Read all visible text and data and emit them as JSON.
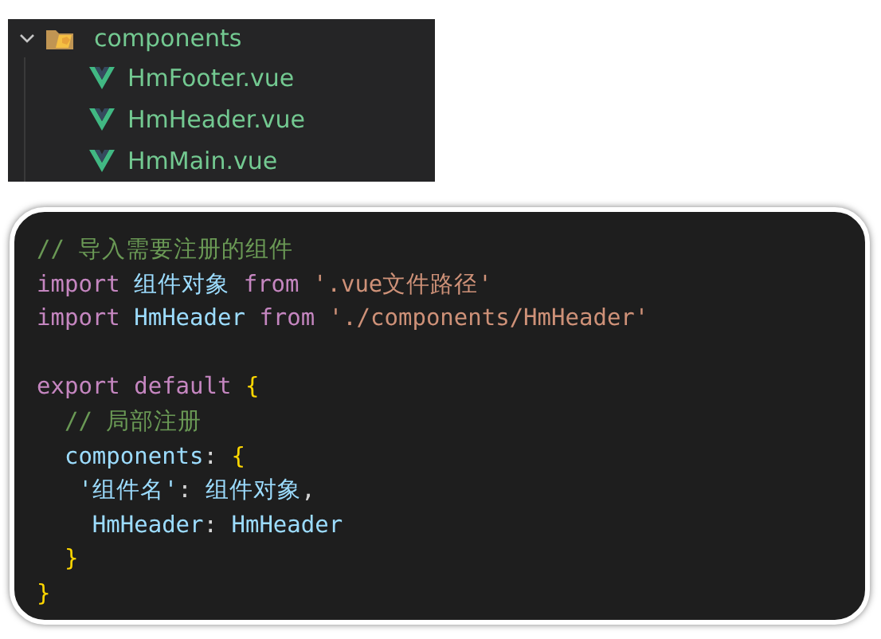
{
  "explorer": {
    "folder": {
      "name": "components",
      "expanded": true,
      "children": [
        {
          "name": "HmFooter.vue"
        },
        {
          "name": "HmHeader.vue"
        },
        {
          "name": "HmMain.vue"
        }
      ]
    }
  },
  "code": {
    "lines": [
      {
        "kind": "code",
        "tokens": [
          {
            "text": "// 导入需要注册的组件",
            "kind": "comment"
          }
        ]
      },
      {
        "kind": "code",
        "tokens": [
          {
            "text": "import ",
            "kind": "keyword"
          },
          {
            "text": "组件对象 ",
            "kind": "identifier"
          },
          {
            "text": "from ",
            "kind": "keyword"
          },
          {
            "text": "'.vue文件路径'",
            "kind": "string"
          }
        ]
      },
      {
        "kind": "code",
        "tokens": [
          {
            "text": "import ",
            "kind": "keyword"
          },
          {
            "text": "HmHeader ",
            "kind": "identifier"
          },
          {
            "text": "from ",
            "kind": "keyword"
          },
          {
            "text": "'./components/HmHeader'",
            "kind": "string"
          }
        ]
      },
      {
        "kind": "blank"
      },
      {
        "kind": "code",
        "tokens": [
          {
            "text": "export default ",
            "kind": "keyword"
          },
          {
            "text": "{",
            "kind": "brace"
          }
        ]
      },
      {
        "kind": "code",
        "tokens": [
          {
            "text": "  // 局部注册",
            "kind": "comment"
          }
        ]
      },
      {
        "kind": "code",
        "tokens": [
          {
            "text": "  components",
            "kind": "identifier"
          },
          {
            "text": ": ",
            "kind": "punct"
          },
          {
            "text": "{",
            "kind": "brace"
          }
        ]
      },
      {
        "kind": "code",
        "tokens": [
          {
            "text": "   '组件名'",
            "kind": "identifier"
          },
          {
            "text": ": ",
            "kind": "punct"
          },
          {
            "text": "组件对象",
            "kind": "identifier"
          },
          {
            "text": ",",
            "kind": "punct"
          }
        ]
      },
      {
        "kind": "code",
        "tokens": [
          {
            "text": "    HmHeader",
            "kind": "identifier"
          },
          {
            "text": ": ",
            "kind": "punct"
          },
          {
            "text": "HmHeader",
            "kind": "identifier"
          }
        ]
      },
      {
        "kind": "code",
        "tokens": [
          {
            "text": "  }",
            "kind": "brace"
          }
        ]
      },
      {
        "kind": "code",
        "tokens": [
          {
            "text": "}",
            "kind": "brace"
          }
        ]
      }
    ]
  }
}
